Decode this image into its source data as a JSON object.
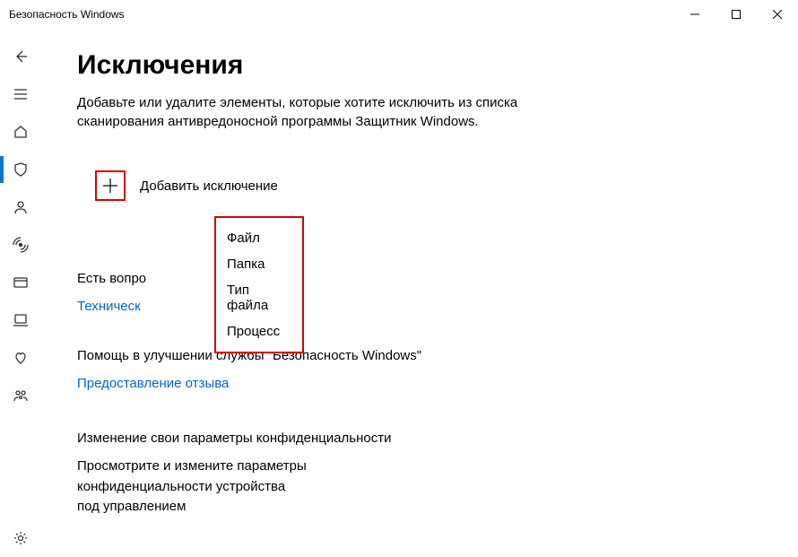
{
  "window": {
    "title": "Безопасность Windows"
  },
  "page": {
    "title": "Исключения",
    "description": "Добавьте или удалите элементы, которые хотите исключить из списка сканирования антивредоносной программы Защитник Windows.",
    "add_label": "Добавить исключение"
  },
  "dropdown": {
    "items": [
      "Файл",
      "Папка",
      "Тип файла",
      "Процесс"
    ]
  },
  "sections": {
    "questions": {
      "title_partial": "Есть вопро",
      "link_partial": "Техническ"
    },
    "feedback": {
      "title": "Помощь в улучшении службы \"Безопасность Windows\"",
      "link": "Предоставление отзыва"
    },
    "privacy": {
      "title": "Изменение свои параметры конфиденциальности",
      "desc": "Просмотрите и измените параметры конфиденциальности устройства под управлением"
    }
  }
}
